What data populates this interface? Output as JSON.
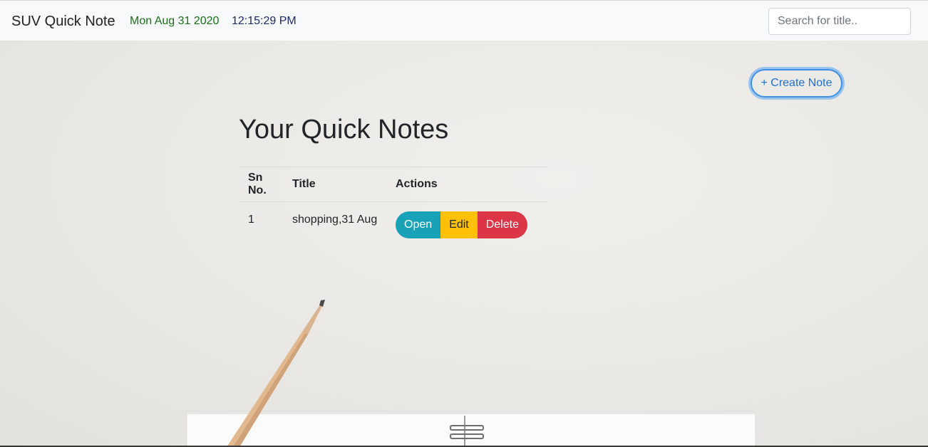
{
  "navbar": {
    "brand": "SUV Quick Note",
    "date": "Mon Aug 31 2020",
    "time": "12:15:29 PM",
    "search_placeholder": "Search for title.."
  },
  "create_button_label": "+ Create Note",
  "page_title": "Your Quick Notes",
  "table": {
    "headers": [
      "Sn No.",
      "Title",
      "Actions"
    ],
    "rows": [
      {
        "sn": "1",
        "title": "shopping,31 Aug",
        "actions": {
          "open": "Open",
          "edit": "Edit",
          "delete": "Delete"
        }
      }
    ]
  },
  "colors": {
    "open": "#17a2b8",
    "edit": "#ffc107",
    "delete": "#dc3545",
    "accent": "#007bff"
  },
  "icons": [
    "pencil-illustration",
    "notebook-illustration"
  ]
}
